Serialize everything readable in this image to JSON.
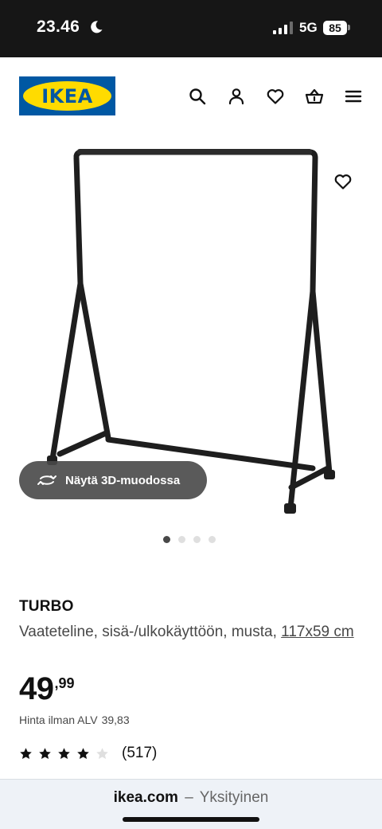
{
  "status_bar": {
    "time": "23.46",
    "network": "5G",
    "battery": "85"
  },
  "header": {
    "logo_text": "IKEA",
    "icons": [
      "search-icon",
      "user-icon",
      "heart-icon",
      "basket-icon",
      "menu-icon"
    ]
  },
  "gallery": {
    "view_3d_label": "Näytä 3D-muodossa",
    "slide_count": 4,
    "active_slide": 1
  },
  "product": {
    "name": "TURBO",
    "description": "Vaateteline, sisä-/ulkokäyttöön, musta, ",
    "size": "117x59 cm",
    "price_integer": "49",
    "price_decimals": ",99",
    "vat_label": "Hinta ilman ALV",
    "vat_price": "39,83",
    "rating": 4,
    "rating_max": 5,
    "review_count": "(517)"
  },
  "browser": {
    "domain": "ikea.com",
    "separator": "–",
    "mode": "Yksityinen"
  },
  "colors": {
    "brand_blue": "#0058a3",
    "brand_yellow": "#ffdb00",
    "status_bar": "#161616"
  }
}
